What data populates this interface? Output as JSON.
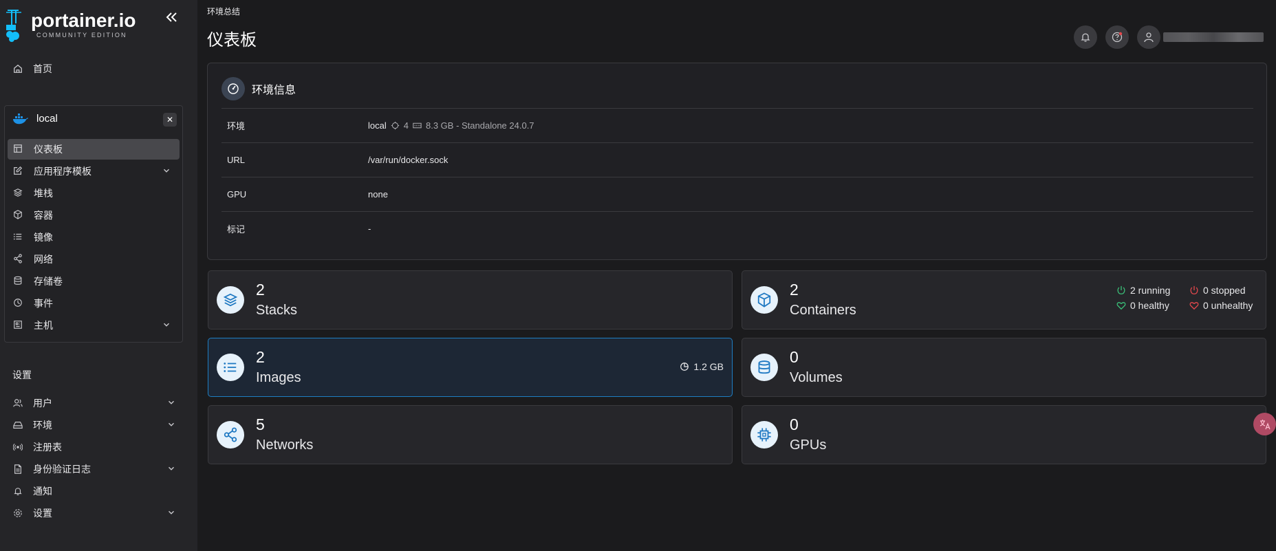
{
  "brand": {
    "name": "portainer.io",
    "edition": "COMMUNITY EDITION"
  },
  "sidebar": {
    "home": "首页",
    "environment": {
      "name": "local",
      "items": [
        {
          "label": "仪表板",
          "icon": "dashboard-icon",
          "active": true
        },
        {
          "label": "应用程序模板",
          "icon": "edit-icon",
          "expandable": true
        },
        {
          "label": "堆栈",
          "icon": "layers-icon"
        },
        {
          "label": "容器",
          "icon": "box-icon"
        },
        {
          "label": "镜像",
          "icon": "list-icon"
        },
        {
          "label": "网络",
          "icon": "share-icon"
        },
        {
          "label": "存储卷",
          "icon": "database-icon"
        },
        {
          "label": "事件",
          "icon": "clock-icon"
        },
        {
          "label": "主机",
          "icon": "host-icon",
          "expandable": true
        }
      ]
    },
    "settings_title": "设置",
    "settings_items": [
      {
        "label": "用户",
        "icon": "users-icon",
        "expandable": true
      },
      {
        "label": "环境",
        "icon": "drive-icon",
        "expandable": true
      },
      {
        "label": "注册表",
        "icon": "radio-icon"
      },
      {
        "label": "身份验证日志",
        "icon": "file-icon",
        "expandable": true
      },
      {
        "label": "通知",
        "icon": "bell-icon"
      },
      {
        "label": "设置",
        "icon": "gear-icon",
        "expandable": true
      }
    ]
  },
  "header": {
    "breadcrumb": "环境总结",
    "title": "仪表板"
  },
  "env_info": {
    "title": "环境信息",
    "rows": [
      {
        "key": "环境",
        "value": "local",
        "cpu": "4",
        "memory": "8.3 GB - Standalone 24.0.7"
      },
      {
        "key": "URL",
        "value": "/var/run/docker.sock"
      },
      {
        "key": "GPU",
        "value": "none"
      },
      {
        "key": "标记",
        "value": "-"
      }
    ]
  },
  "stats": {
    "stacks": {
      "count": "2",
      "label": "Stacks"
    },
    "containers": {
      "count": "2",
      "label": "Containers",
      "running": "2 running",
      "stopped": "0 stopped",
      "healthy": "0 healthy",
      "unhealthy": "0 unhealthy"
    },
    "images": {
      "count": "2",
      "label": "Images",
      "size": "1.2 GB"
    },
    "volumes": {
      "count": "0",
      "label": "Volumes"
    },
    "networks": {
      "count": "5",
      "label": "Networks"
    },
    "gpus": {
      "count": "0",
      "label": "GPUs"
    }
  },
  "colors": {
    "accent": "#1e78c2",
    "running": "#3bc27a",
    "stopped": "#e5484d"
  }
}
